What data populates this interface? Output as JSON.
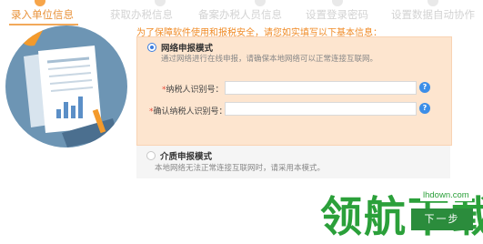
{
  "steps": [
    {
      "label": "录入单位信息",
      "active": true
    },
    {
      "label": "获取办税信息",
      "active": false
    },
    {
      "label": "备案办税人员信息",
      "active": false
    },
    {
      "label": "设置登录密码",
      "active": false
    },
    {
      "label": "设置数据自动协作",
      "active": false
    }
  ],
  "notice": "为了保障软件使用和报税安全，请您如实填写以下基本信息：",
  "online_mode": {
    "title": "网络申报模式",
    "desc": "通过网络进行在线申报，请确保本地网络可以正常连接互联网。",
    "selected": true
  },
  "form": {
    "taxpayer_id_label": "纳税人识别号：",
    "confirm_id_label": "确认纳税人识别号：",
    "required_mark": "*",
    "taxpayer_id_value": "",
    "confirm_id_value": "",
    "help_glyph": "?"
  },
  "media_mode": {
    "title": "介质申报模式",
    "desc": "本地网络无法正常连接互联网时，请采用本模式。",
    "selected": false
  },
  "next_button": "下一步",
  "watermark": {
    "text": "领航下载",
    "url": "lhdown.com"
  },
  "colors": {
    "accent": "#e8923a",
    "panel": "#fde5cf",
    "primary": "#2b8c3c",
    "help": "#3c8ee8"
  }
}
